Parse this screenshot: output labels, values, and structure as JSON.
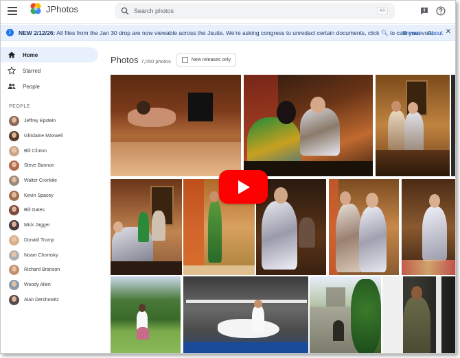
{
  "app": {
    "brand": "JPhotos",
    "search_placeholder": "Search photos",
    "search_shortcut": "⌘K"
  },
  "banner": {
    "date": "NEW 2/12/26:",
    "text": "All files from the Jan 30 drop are now viewable across the Jsuite. We're asking congress to unredact certain documents, click",
    "text_after": "to cast your vote.",
    "browse": "Browse",
    "about": "About"
  },
  "nav": [
    {
      "label": "Home",
      "icon": "home-icon",
      "active": true
    },
    {
      "label": "Starred",
      "icon": "star-icon",
      "active": false
    },
    {
      "label": "People",
      "icon": "people-icon",
      "active": false
    }
  ],
  "people_section_title": "PEOPLE",
  "people": [
    {
      "name": "Jeffrey Epstein",
      "color": "#8a6a5a"
    },
    {
      "name": "Ghislaine Maxwell",
      "color": "#5a3a2a"
    },
    {
      "name": "Bill Clinton",
      "color": "#c9a68a"
    },
    {
      "name": "Steve Bannon",
      "color": "#b06a4a"
    },
    {
      "name": "Walter Cronkite",
      "color": "#9a8a7a"
    },
    {
      "name": "Kevin Spacey",
      "color": "#a07050"
    },
    {
      "name": "Bill Gates",
      "color": "#7a4a3a"
    },
    {
      "name": "Mick Jagger",
      "color": "#4a3a3a"
    },
    {
      "name": "Donald Trump",
      "color": "#d9b08a"
    },
    {
      "name": "Noam Chomsky",
      "color": "#b0b0b0"
    },
    {
      "name": "Richard Branson",
      "color": "#c09070"
    },
    {
      "name": "Woody Allen",
      "color": "#8a9aaa"
    },
    {
      "name": "Alan Dershowitz",
      "color": "#5a4a4a"
    }
  ],
  "main": {
    "title": "Photos",
    "count": "7,050 photos",
    "filter_label": "New releases only"
  },
  "colors": {
    "accent": "#1a73e8",
    "banner_bg": "#e8f0fe",
    "play_button": "#ff0000"
  }
}
